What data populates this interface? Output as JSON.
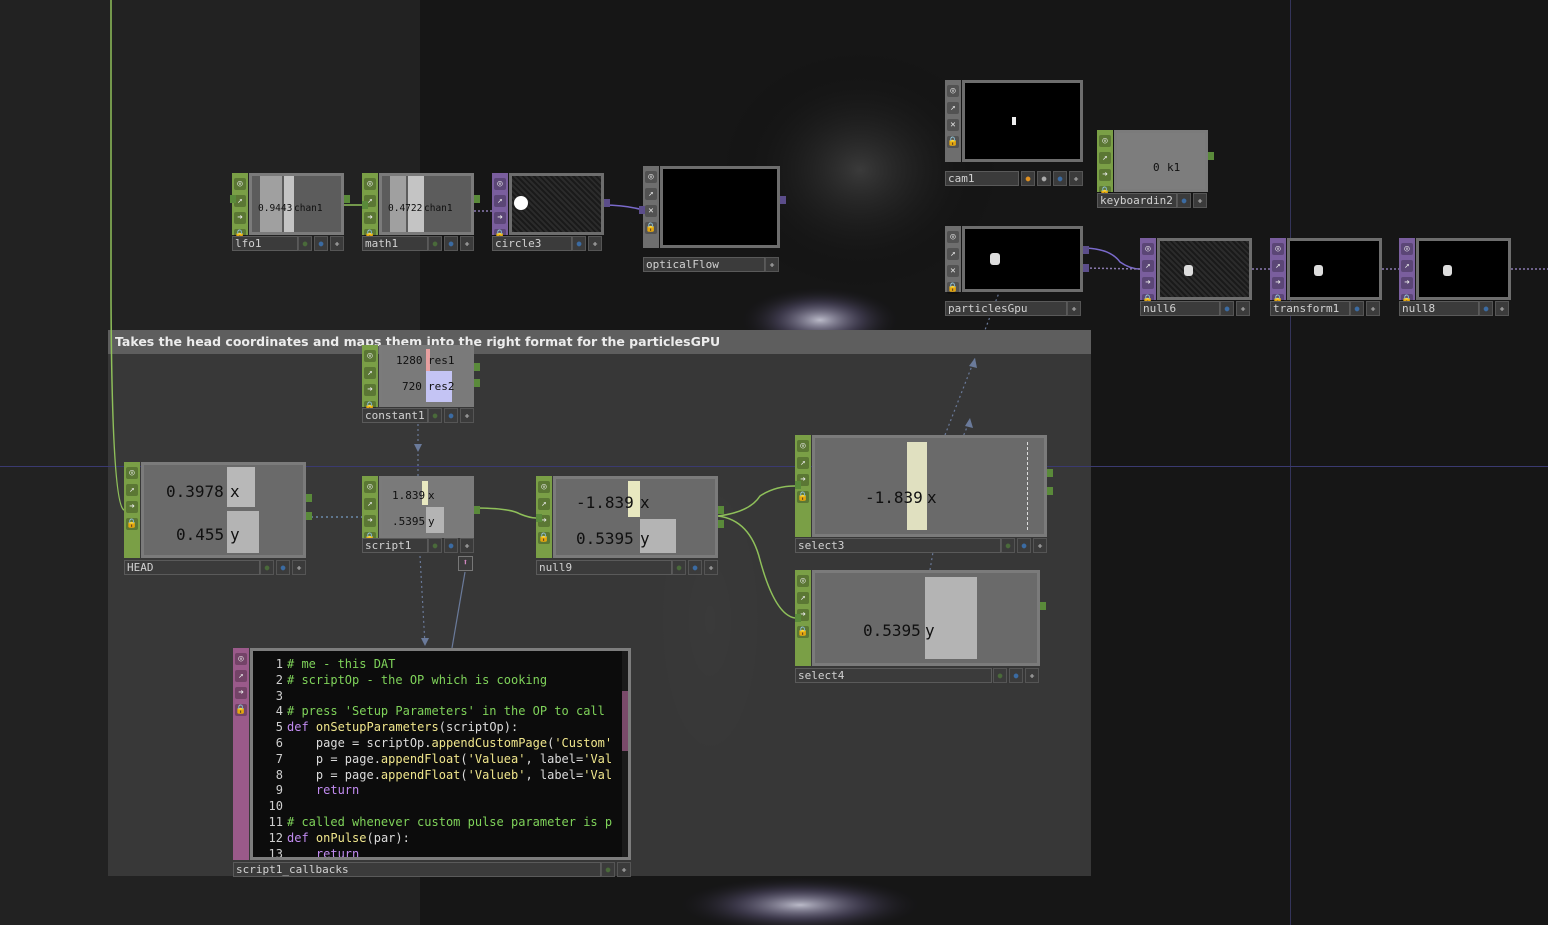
{
  "annotation": {
    "text": "Takes the head coordinates and maps them into the right format for the particlesGPU"
  },
  "nodes": {
    "lfo1": {
      "name": "lfo1",
      "value": "0.9443",
      "channel": "chan1"
    },
    "math1": {
      "name": "math1",
      "value": "0.4722",
      "channel": "chan1"
    },
    "circle3": {
      "name": "circle3"
    },
    "opticalFlow": {
      "name": "opticalFlow"
    },
    "cam1": {
      "name": "cam1"
    },
    "keyboardin2": {
      "name": "keyboardin2",
      "value": "0",
      "channel": "k1"
    },
    "particlesGpu": {
      "name": "particlesGpu"
    },
    "null6": {
      "name": "null6"
    },
    "transform1": {
      "name": "transform1"
    },
    "null8": {
      "name": "null8"
    },
    "constant1": {
      "name": "constant1",
      "v1": "1280",
      "c1": "res1",
      "v2": "720",
      "c2": "res2"
    },
    "head": {
      "name": "HEAD",
      "v1": "0.3978",
      "c1": "x",
      "v2": "0.455",
      "c2": "y"
    },
    "script1": {
      "name": "script1",
      "v1": "1.839",
      "c1": "x",
      "v2": ".5395",
      "c2": "y"
    },
    "null9": {
      "name": "null9",
      "v1": "-1.839",
      "c1": "x",
      "v2": "0.5395",
      "c2": "y"
    },
    "select3": {
      "name": "select3",
      "value": "-1.839",
      "channel": "x"
    },
    "select4": {
      "name": "select4",
      "value": "0.5395",
      "channel": "y"
    },
    "script1_callbacks": {
      "name": "script1_callbacks",
      "lines": [
        {
          "n": "1",
          "t": "# me - this DAT",
          "k": "com"
        },
        {
          "n": "2",
          "t": "# scriptOp - the OP which is cooking",
          "k": "com"
        },
        {
          "n": "3",
          "t": "",
          "k": "txt"
        },
        {
          "n": "4",
          "t": "# press 'Setup Parameters' in the OP to call",
          "k": "com"
        },
        {
          "n": "5",
          "t": "def onSetupParameters(scriptOp):",
          "k": "def"
        },
        {
          "n": "6",
          "t": "    page = scriptOp.appendCustomPage('Custom'",
          "k": "txt"
        },
        {
          "n": "7",
          "t": "    p = page.appendFloat('Valuea', label='Val",
          "k": "txt"
        },
        {
          "n": "8",
          "t": "    p = page.appendFloat('Valueb', label='Val",
          "k": "txt"
        },
        {
          "n": "9",
          "t": "    return",
          "k": "kw"
        },
        {
          "n": "10",
          "t": "",
          "k": "txt"
        },
        {
          "n": "11",
          "t": "# called whenever custom pulse parameter is p",
          "k": "com"
        },
        {
          "n": "12",
          "t": "def onPulse(par):",
          "k": "def"
        },
        {
          "n": "13",
          "t": "    return",
          "k": "kw"
        }
      ]
    }
  },
  "colors": {
    "chop": "#7a9f46",
    "top": "#7a5e9e",
    "dat": "#9a5a8a",
    "wire_chop": "#8fc05a",
    "wire_top": "#7a6acb",
    "wire_dep": "#6a7a9a"
  }
}
